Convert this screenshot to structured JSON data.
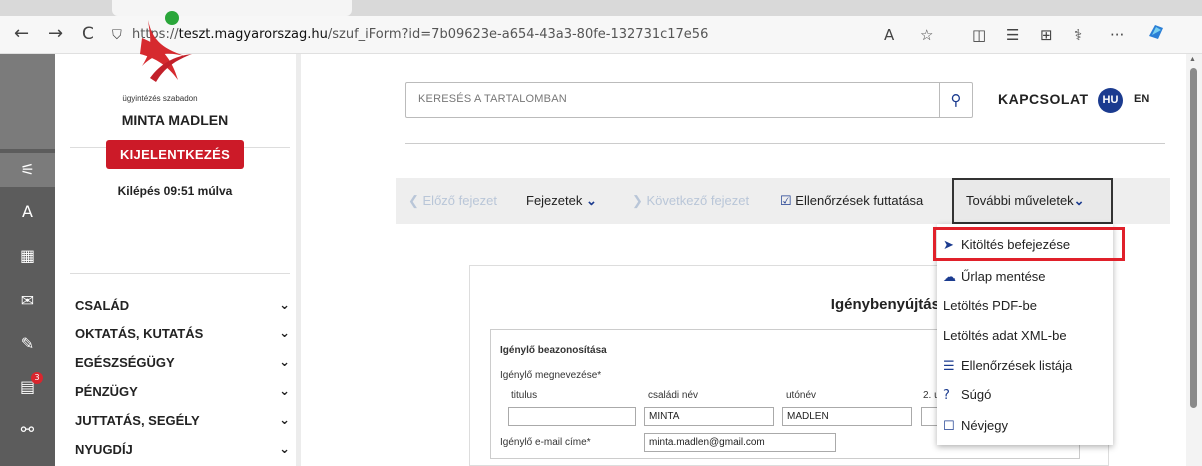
{
  "browser": {
    "url_prefix": "https://",
    "url_host": "teszt.magyarorszag.hu",
    "url_path": "/szuf_iForm?id=7b09623e-a654-43a3-80fe-132731c17e56",
    "back_icon": "←",
    "forward_icon": "→",
    "reload_icon": "C",
    "lock_icon": "⛉",
    "read_aloud_icon": "A",
    "star_icon": "☆",
    "split_icon": "◫",
    "favorites_icon": "☰",
    "collections_icon": "⊞",
    "perf_icon": "⚕",
    "more_icon": "···"
  },
  "rail": {
    "active_icon": "⚟",
    "user_icon": "A",
    "calendar_icon": "▦",
    "mail_icon": "✉",
    "tools_icon": "✎",
    "docs_icon": "▤",
    "docs_badge": "3",
    "link_icon": "⚯"
  },
  "sidebar": {
    "logo_tagline": "ügyintézés szabadon",
    "user_name": "MINTA MADLEN",
    "logout_label": "KIJELENTKEZÉS",
    "timer_text": "Kilépés 09:51 múlva",
    "menu": [
      {
        "label": "CSALÁD"
      },
      {
        "label": "OKTATÁS, KUTATÁS"
      },
      {
        "label": "EGÉSZSÉGÜGY"
      },
      {
        "label": "PÉNZÜGY"
      },
      {
        "label": "JUTTATÁS, SEGÉLY"
      },
      {
        "label": "NYUGDÍJ"
      }
    ],
    "chevron": "⌄"
  },
  "header": {
    "search_placeholder": "KERESÉS A TARTALOMBAN",
    "search_icon": "⚲",
    "contact_label": "KAPCSOLAT",
    "lang_hu": "HU",
    "lang_en": "EN"
  },
  "toolbar": {
    "prev_chapter": "Előző fejezet",
    "chapters": "Fejezetek",
    "next_chapter": "Következő fejezet",
    "run_checks": "Ellenőrzések futtatása",
    "more_actions": "További műveletek"
  },
  "dropdown": {
    "items": [
      {
        "label": "Kitöltés befejezése",
        "icon": "➤"
      },
      {
        "label": "Űrlap mentése",
        "icon": "☁"
      },
      {
        "label": "Letöltés PDF-be",
        "icon": ""
      },
      {
        "label": "Letöltés adat XML-be",
        "icon": ""
      },
      {
        "label": "Ellenőrzések listája",
        "icon": "☰"
      },
      {
        "label": "Súgó",
        "icon": "?"
      },
      {
        "label": "Névjegy",
        "icon": "☐"
      }
    ]
  },
  "form": {
    "title": "Igénybenyújtási űrlap",
    "section_title": "Igénylő beazonosítása",
    "name_label": "Igénylő megnevezése*",
    "col_title": "titulus",
    "col_family": "családi név",
    "col_given": "utónév",
    "col_second": "2. u",
    "family_value": "MINTA",
    "given_value": "MADLEN",
    "email_label": "Igénylő e-mail címe*",
    "email_value": "minta.madlen@gmail.com"
  }
}
